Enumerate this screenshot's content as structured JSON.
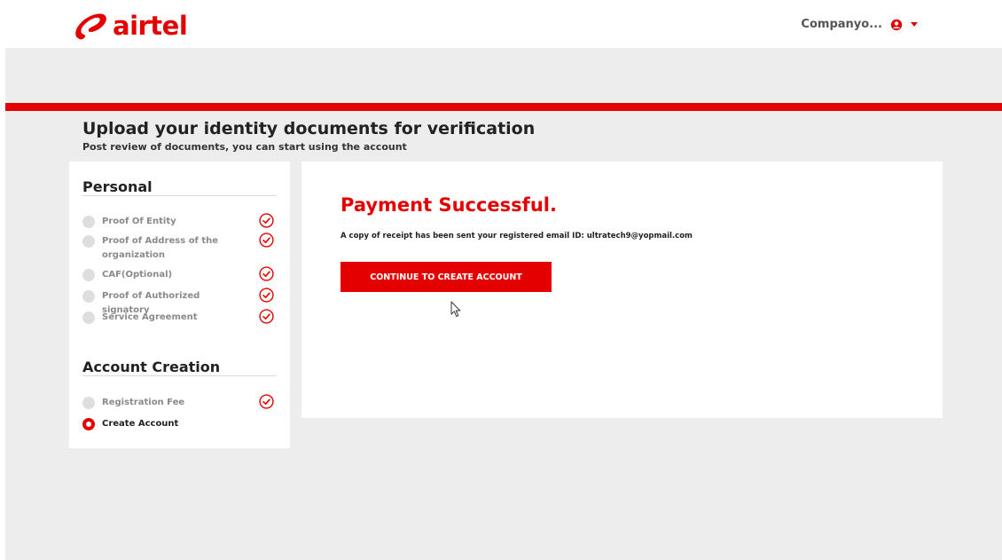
{
  "brand": {
    "name": "airtel",
    "color": "#e40000"
  },
  "header": {
    "user_name": "Companyo...",
    "user_icon": "user-circle-icon",
    "menu_icon": "caret-down-icon"
  },
  "page": {
    "title": "Upload your identity documents for verification",
    "subtitle": "Post review of documents, you can start using the account"
  },
  "sidebar": {
    "sections": [
      {
        "title": "Personal",
        "steps": [
          {
            "label": "Proof Of Entity",
            "completed": true
          },
          {
            "label": "Proof of Address of the organization",
            "completed": true
          },
          {
            "label": "CAF(Optional)",
            "completed": true
          },
          {
            "label": "Proof of Authorized signatory",
            "completed": true
          },
          {
            "label": "Service Agreement",
            "completed": true
          }
        ]
      },
      {
        "title": "Account Creation",
        "steps": [
          {
            "label": "Registration Fee",
            "completed": true
          },
          {
            "label": "Create Account",
            "completed": false,
            "active": true
          }
        ]
      }
    ]
  },
  "main": {
    "heading": "Payment Successful.",
    "message": "A copy of receipt has been sent your registered email ID: ultratech9@yopmail.com",
    "continue_label": "CONTINUE TO CREATE ACCOUNT"
  }
}
